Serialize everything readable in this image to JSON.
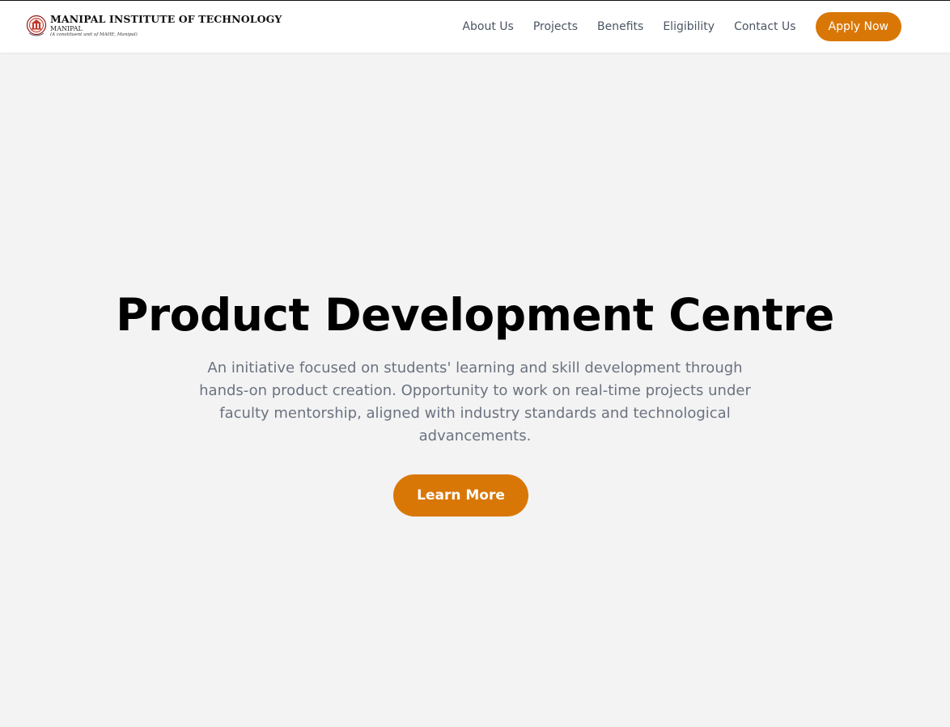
{
  "header": {
    "logo": {
      "title": "MANIPAL INSTITUTE OF TECHNOLOGY",
      "subtitle": "MANIPAL",
      "tagline": "(A constituent unit of MAHE, Manipal)",
      "icon": "institute-crest-icon",
      "crest_color": "#c0392b"
    },
    "nav": {
      "items": [
        {
          "label": "About Us"
        },
        {
          "label": "Projects"
        },
        {
          "label": "Benefits"
        },
        {
          "label": "Eligibility"
        },
        {
          "label": "Contact Us"
        }
      ],
      "apply_label": "Apply Now"
    }
  },
  "hero": {
    "title": "Product Development Centre",
    "description": "An initiative focused on students' learning and skill development through hands-on product creation. Opportunity to work on real-time projects under faculty mentorship, aligned with industry standards and technological advancements.",
    "cta_label": "Learn More"
  },
  "colors": {
    "accent": "#d97706",
    "background": "#f3f3f3",
    "header_bg": "#ffffff",
    "nav_text": "#4b5563",
    "body_text": "#6b7280"
  }
}
